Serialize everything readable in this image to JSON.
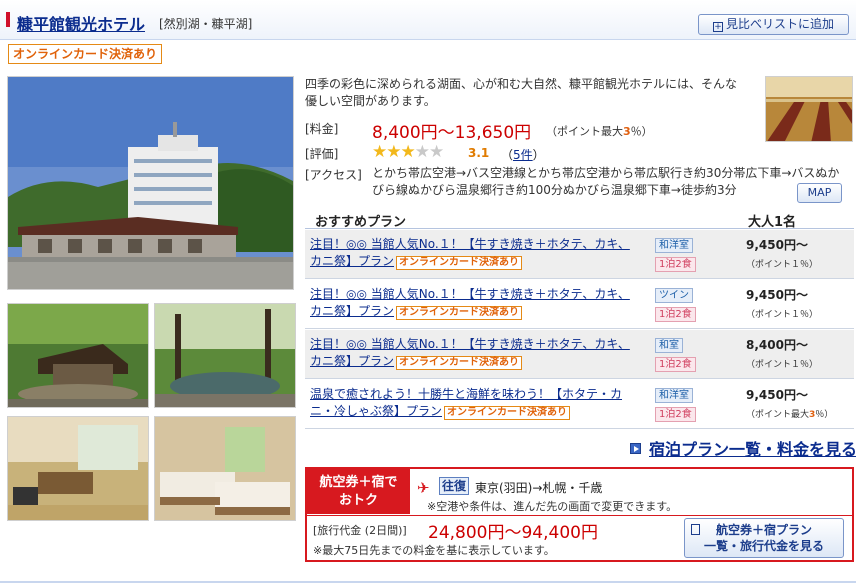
{
  "header": {
    "hotel_name": "糠平館観光ホテル",
    "area": "[然別湖・糠平湖]",
    "compare_button": "見比べリストに追加",
    "online_badge": "オンラインカード決済あり"
  },
  "description": "四季の彩色に深められる湖面、心が和む大自然、糠平館観光ホテルには、そんな優しい空間があります。",
  "info": {
    "price_label": "[料金]",
    "price": "8,400円〜13,650円",
    "points_max_prefix": "（ポイント最大",
    "points_max_value": "3",
    "points_max_suffix": "％）",
    "rating_label": "[評価]",
    "stars_filled": 3,
    "stars_total": 5,
    "rating_value": "3.1",
    "reviews_open": "（",
    "reviews": "5件",
    "reviews_close": "）",
    "access_label": "[アクセス]",
    "access": "とかち帯広空港→バス空港線とかち帯広空港から帯広駅行き約30分帯広下車→バスぬかびら線ぬかびら温泉郷行き約100分ぬかびら温泉郷下車→徒歩約3分",
    "map_button": "MAP"
  },
  "plans": {
    "header_name": "おすすめプラン",
    "header_price": "大人1名",
    "items": [
      {
        "title": "注目！◎◎ 当館人気No.１！【牛すき焼き＋ホタテ、カキ、カニ祭】プラン",
        "badge": "オンラインカード決済あり",
        "room": "和洋室",
        "meal": "1泊2食",
        "price": "9,450円〜",
        "points": "（ポイント１％）"
      },
      {
        "title": "注目！◎◎ 当館人気No.１！【牛すき焼き＋ホタテ、カキ、カニ祭】プラン",
        "badge": "オンラインカード決済あり",
        "room": "ツイン",
        "meal": "1泊2食",
        "price": "9,450円〜",
        "points": "（ポイント１％）"
      },
      {
        "title": "注目！◎◎ 当館人気No.１！【牛すき焼き＋ホタテ、カキ、カニ祭】プラン",
        "badge": "オンラインカード決済あり",
        "room": "和室",
        "meal": "1泊2食",
        "price": "8,400円〜",
        "points": "（ポイント１％）"
      },
      {
        "title": "温泉で癒されよう！十勝牛と海鮮を味わう！【ホタテ・カニ・冷しゃぶ祭】プラン",
        "badge": "オンラインカード決済あり",
        "room": "和洋室",
        "meal": "1泊2食",
        "price": "9,450円〜",
        "points_prefix": "（ポイント最大",
        "points_value": "3",
        "points_suffix": "％）"
      }
    ],
    "all_plans_link": "宿泊プラン一覧・料金を見る"
  },
  "air": {
    "label_line1": "航空券＋宿で",
    "label_line2": "おトク",
    "roundtrip": "往復",
    "route": "東京(羽田)→札幌・千歳",
    "note": "※空港や条件は、進んだ先の画面で変更できます。",
    "travel_label": "[旅行代金 (2日間)]",
    "travel_price": "24,800円〜94,400円",
    "travel_note": "※最大75日先までの料金を基に表示しています。",
    "button_line1": "航空券＋宿プラン",
    "button_line2": "一覧・旅行代金を見る"
  },
  "colors": {
    "link": "#0b2c8e",
    "price": "#cc0000",
    "accent": "#d7191f",
    "badge": "#e58a16"
  },
  "icons": [
    "plus-square-icon",
    "star-icon",
    "arrow-square-icon",
    "plane-icon",
    "document-icon"
  ]
}
